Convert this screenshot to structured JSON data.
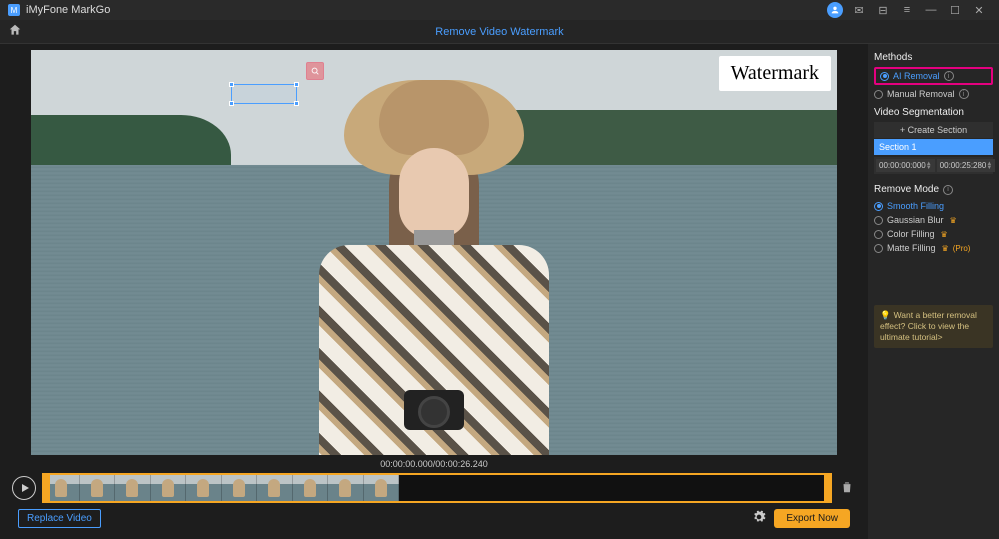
{
  "titlebar": {
    "app_name": "iMyFone MarkGo"
  },
  "subbar": {
    "title": "Remove Video Watermark"
  },
  "preview": {
    "watermark_text": "Watermark",
    "timecode": "00:00:00.000/00:00:26.240"
  },
  "sidebar": {
    "methods_title": "Methods",
    "method_ai": "AI Removal",
    "method_manual": "Manual Removal",
    "seg_title": "Video Segmentation",
    "create_section": "+ Create Section",
    "section1": "Section 1",
    "time_start": "00:00:00:000",
    "time_end": "00:00:25:280",
    "mode_title": "Remove Mode",
    "mode_smooth": "Smooth Filling",
    "mode_gaussian": "Gaussian Blur",
    "mode_color": "Color Filling",
    "mode_matte": "Matte Filling",
    "pro_label": "(Pro)",
    "tip_text": "Want a better removal effect? Click to view the ultimate tutorial>"
  },
  "footer": {
    "replace": "Replace Video",
    "export": "Export Now"
  }
}
